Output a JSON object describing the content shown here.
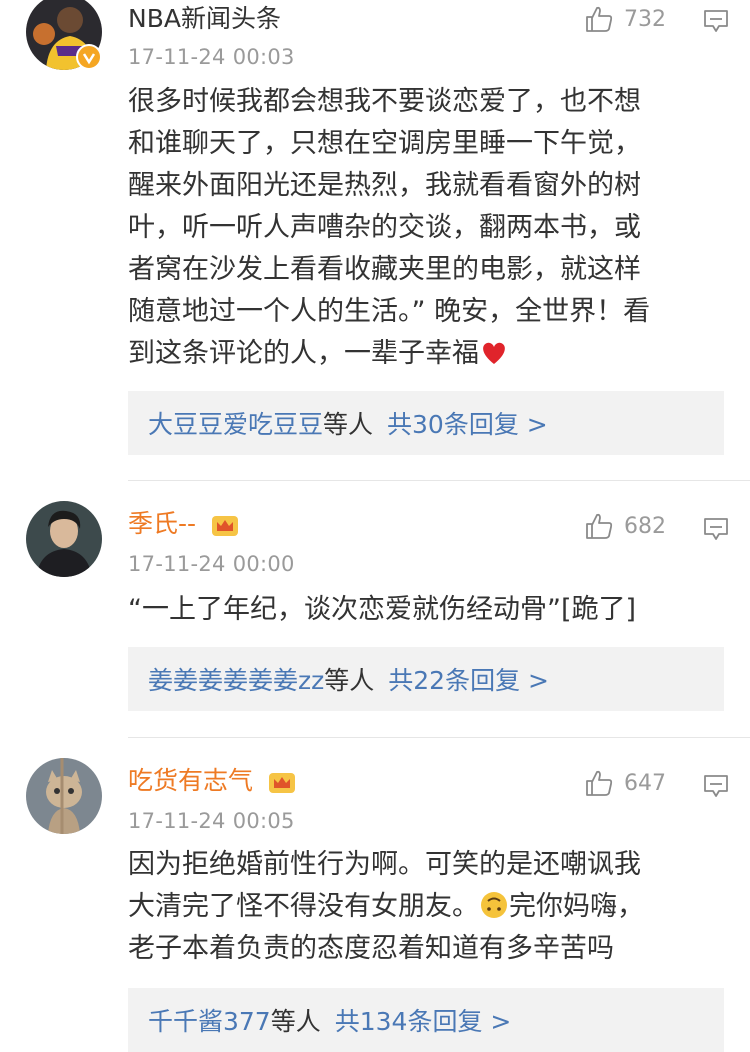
{
  "comments": [
    {
      "username": "NBA新闻头条",
      "timestamp": "17-11-24 00:03",
      "likes": "732",
      "verified": true,
      "lines": [
        "很多时候我都会想我不要谈恋爱了，也不想",
        "和谁聊天了，只想在空调房里睡一下午觉，",
        "醒来外面阳光还是热烈，我就看看窗外的树",
        "叶，听一听人声嘈杂的交谈，翻两本书，或",
        "者窝在沙发上看看收藏夹里的电影，就这样",
        "随意地过一个人的生活。” 晚安，全世界！看",
        "到这条评论的人，一辈子幸福"
      ],
      "emoji": "red-heart",
      "reply_users": "大豆豆爱吃豆豆",
      "reply_mid": "等人",
      "reply_count": "共30条回复 >"
    },
    {
      "username": "季氏--",
      "timestamp": "17-11-24 00:00",
      "likes": "682",
      "badge": "crown-icon",
      "lines": [
        "“一上了年纪，谈次恋爱就伤经动骨”[跪了]"
      ],
      "reply_users": "姜姜姜姜姜姜zz",
      "reply_mid": "等人",
      "reply_count": "共22条回复 >"
    },
    {
      "username": "吃货有志气",
      "timestamp": "17-11-24 00:05",
      "likes": "647",
      "badge": "crown-icon",
      "lines": [
        "因为拒绝婚前性行为啊。可笑的是还嘲讽我",
        "大清完了怪不得没有女朋友。",
        "老子本着负责的态度忍着知道有多辛苦吗"
      ],
      "line2_suffix": "完你妈嗨，",
      "emoji": "upside-down-face",
      "reply_users": "千千酱377",
      "reply_mid": "等人",
      "reply_count": "共134条回复 >"
    }
  ],
  "colors": {
    "username_orange": "#ee7a24",
    "reply_blue": "#4a78b5",
    "meta_gray": "#9a9a9a",
    "reply_bg": "#f2f2f2"
  }
}
